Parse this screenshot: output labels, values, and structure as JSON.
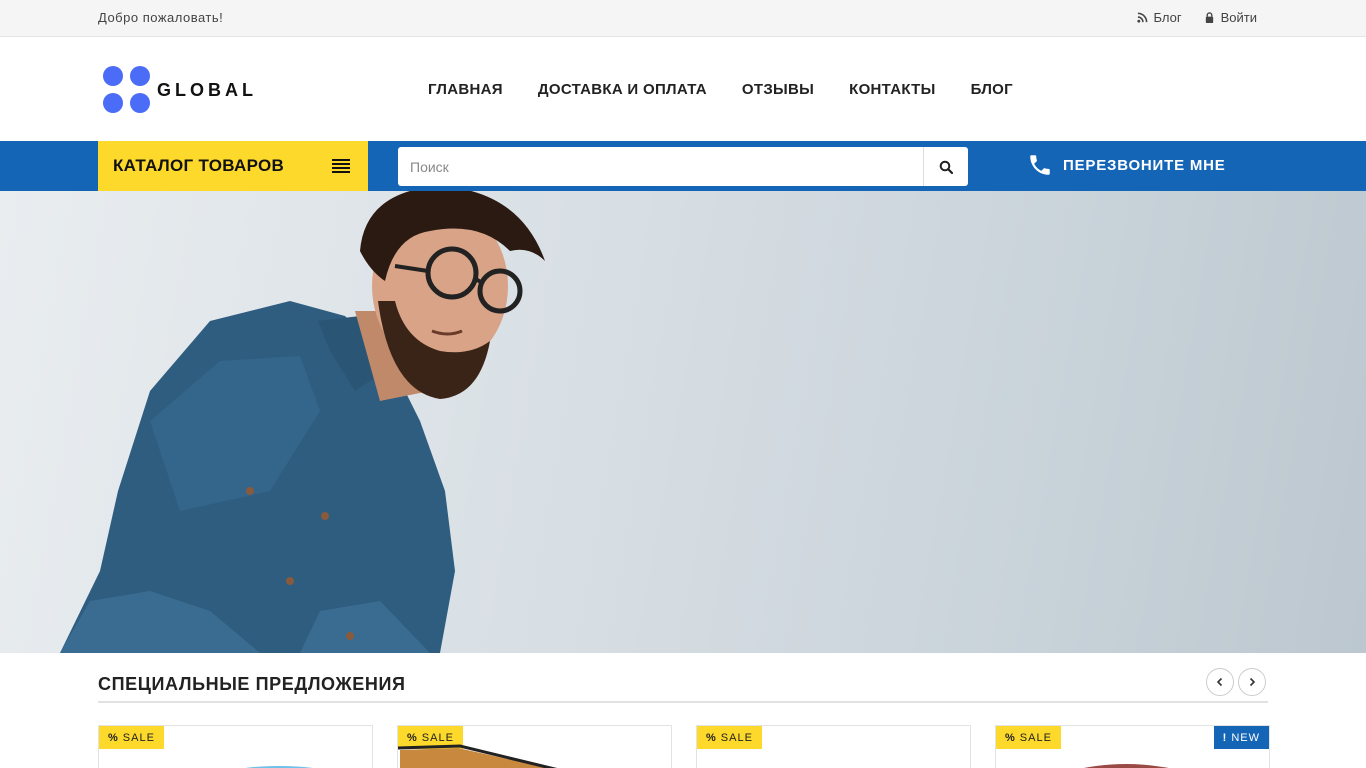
{
  "topbar": {
    "welcome": "Добро пожаловать!",
    "blog_label": "Блог",
    "login_label": "Войти"
  },
  "header": {
    "logo_text": "GLOBAL",
    "logo_color": "#4a6cf7",
    "nav": [
      {
        "label": "ГЛАВНАЯ"
      },
      {
        "label": "ДОСТАВКА И ОПЛАТА"
      },
      {
        "label": "ОТЗЫВЫ"
      },
      {
        "label": "КОНТАКТЫ"
      },
      {
        "label": "БЛОГ"
      }
    ]
  },
  "toolbar": {
    "catalog_label": "КАТАЛОГ ТОВАРОВ",
    "search_placeholder": "Поиск",
    "callback_label": "ПЕРЕЗВОНИТЕ МНЕ",
    "bar_color": "#1565b7",
    "accent_color": "#fdd92b"
  },
  "hero": {
    "image": "bearded man in denim shirt"
  },
  "offers": {
    "title": "СПЕЦИАЛЬНЫЕ ПРЕДЛОЖЕНИЯ",
    "cards": [
      {
        "badge": "SALE"
      },
      {
        "badge": "SALE"
      },
      {
        "badge": "SALE"
      },
      {
        "badge": "SALE",
        "badge2": "NEW"
      }
    ]
  }
}
